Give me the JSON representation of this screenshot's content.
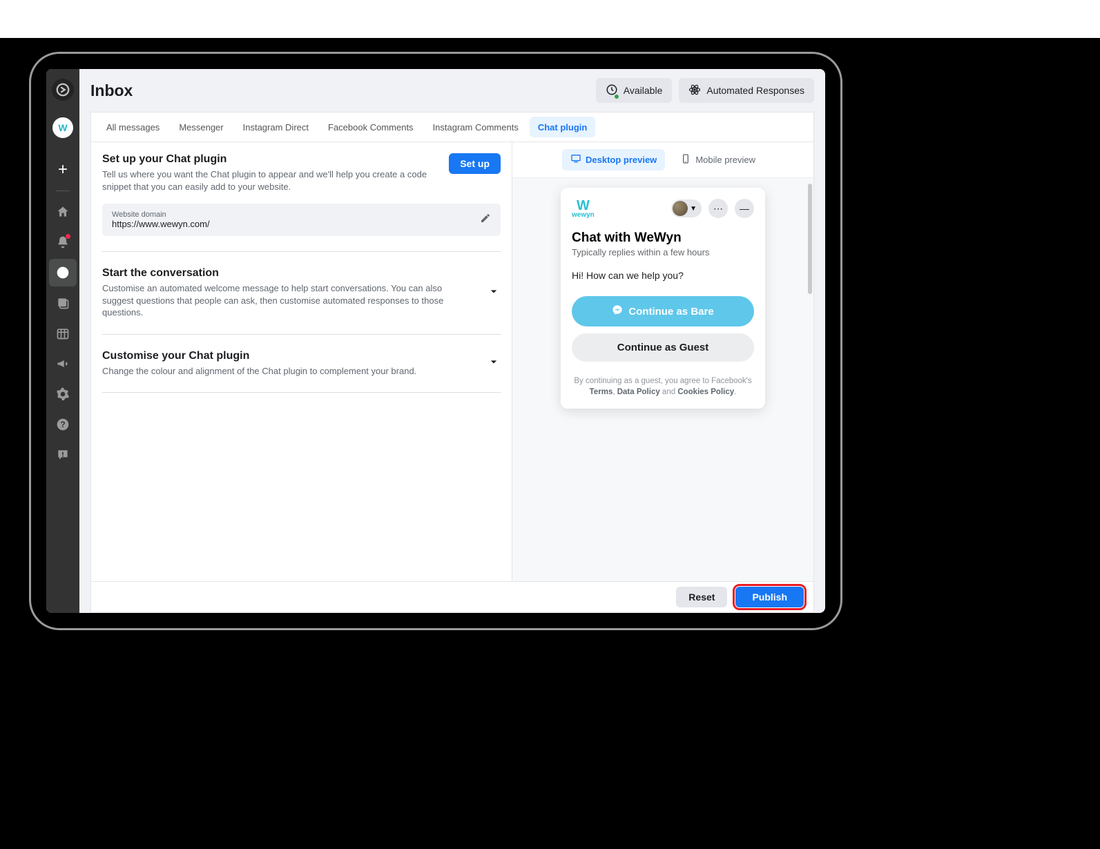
{
  "header": {
    "title": "Inbox",
    "available_label": "Available",
    "automated_label": "Automated Responses"
  },
  "sidebar": {
    "app_name": "wewyn"
  },
  "tabs": {
    "items": [
      {
        "label": "All messages"
      },
      {
        "label": "Messenger"
      },
      {
        "label": "Instagram Direct"
      },
      {
        "label": "Facebook Comments"
      },
      {
        "label": "Instagram Comments"
      },
      {
        "label": "Chat plugin"
      }
    ],
    "active_index": 5
  },
  "setup": {
    "title": "Set up your Chat plugin",
    "desc": "Tell us where you want the Chat plugin to appear and we'll help you create a code snippet that you can easily add to your website.",
    "button": "Set up",
    "domain_label": "Website domain",
    "domain_value": "https://www.wewyn.com/"
  },
  "sections": {
    "start": {
      "title": "Start the conversation",
      "desc": "Customise an automated welcome message to help start conversations. You can also suggest questions that people can ask, then customise automated responses to those questions."
    },
    "customise": {
      "title": "Customise your Chat plugin",
      "desc": "Change the colour and alignment of the Chat plugin to complement your brand."
    }
  },
  "preview": {
    "desktop_label": "Desktop preview",
    "mobile_label": "Mobile preview",
    "brand_small": "wewyn",
    "title": "Chat with WeWyn",
    "subtitle": "Typically replies within a few hours",
    "greeting": "Hi! How can we help you?",
    "continue_as": "Continue as Bare",
    "continue_guest": "Continue as Guest",
    "legal_prefix": "By continuing as a guest, you agree to Facebook's",
    "legal_terms": "Terms",
    "legal_comma": ", ",
    "legal_data": "Data Policy",
    "legal_and": " and ",
    "legal_cookies": "Cookies Policy",
    "legal_period": "."
  },
  "footer": {
    "reset": "Reset",
    "publish": "Publish"
  }
}
